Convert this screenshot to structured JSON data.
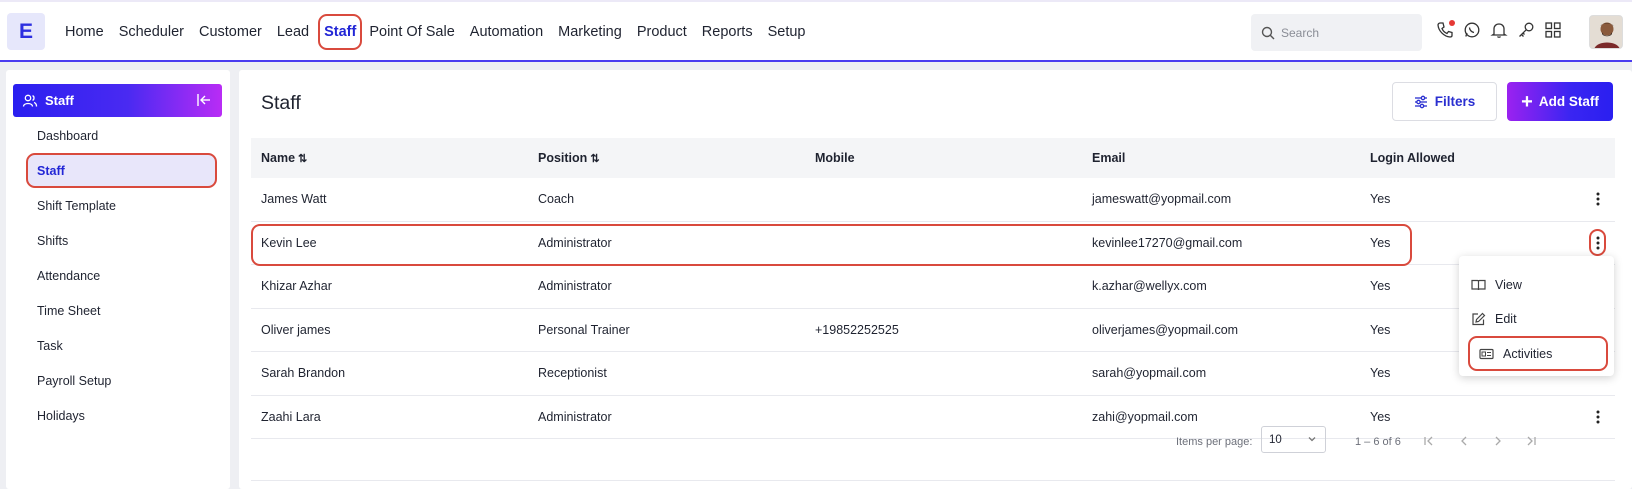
{
  "app": {
    "logo_letter": "E",
    "nav": [
      {
        "label": "Home"
      },
      {
        "label": "Scheduler"
      },
      {
        "label": "Customer"
      },
      {
        "label": "Lead"
      },
      {
        "label": "Staff",
        "active": true
      },
      {
        "label": "Point Of Sale"
      },
      {
        "label": "Automation"
      },
      {
        "label": "Marketing"
      },
      {
        "label": "Product"
      },
      {
        "label": "Reports"
      },
      {
        "label": "Setup"
      }
    ],
    "search": {
      "placeholder": "Search"
    },
    "icons": [
      "phone-icon",
      "whatsapp-icon",
      "bell-icon",
      "key-icon",
      "apps-grid-icon"
    ]
  },
  "sidebar": {
    "header": "Staff",
    "items": [
      {
        "label": "Dashboard"
      },
      {
        "label": "Staff",
        "active": true
      },
      {
        "label": "Shift Template"
      },
      {
        "label": "Shifts"
      },
      {
        "label": "Attendance"
      },
      {
        "label": "Time Sheet"
      },
      {
        "label": "Task"
      },
      {
        "label": "Payroll Setup"
      },
      {
        "label": "Holidays"
      }
    ]
  },
  "main": {
    "title": "Staff",
    "filters_label": "Filters",
    "add_label": "Add Staff",
    "columns": {
      "name": "Name",
      "position": "Position",
      "mobile": "Mobile",
      "email": "Email",
      "login": "Login Allowed"
    },
    "rows": [
      {
        "name": "James Watt",
        "position": "Coach",
        "mobile": "",
        "email": "jameswatt@yopmail.com",
        "login": "Yes"
      },
      {
        "name": "Kevin Lee",
        "position": "Administrator",
        "mobile": "",
        "email": "kevinlee17270@gmail.com",
        "login": "Yes"
      },
      {
        "name": "Khizar Azhar",
        "position": "Administrator",
        "mobile": "",
        "email": "k.azhar@wellyx.com",
        "login": "Yes"
      },
      {
        "name": "Oliver james",
        "position": "Personal Trainer",
        "mobile": "+19852252525",
        "email": "oliverjames@yopmail.com",
        "login": "Yes"
      },
      {
        "name": "Sarah Brandon",
        "position": "Receptionist",
        "mobile": "",
        "email": "sarah@yopmail.com",
        "login": "Yes"
      },
      {
        "name": "Zaahi Lara",
        "position": "Administrator",
        "mobile": "",
        "email": "zahi@yopmail.com",
        "login": "Yes"
      }
    ],
    "pager": {
      "items_label": "Items per page:",
      "page_size": "10",
      "range": "1 – 6 of 6"
    }
  },
  "row_menu": {
    "items": [
      {
        "label": "View",
        "icon": "book-open-icon"
      },
      {
        "label": "Edit",
        "icon": "edit-icon"
      },
      {
        "label": "Activities",
        "icon": "id-card-icon"
      }
    ]
  },
  "colors": {
    "accent": "#2226d6",
    "highlight": "#d94a3d",
    "gradient_start": "#2a1ff0",
    "gradient_end": "#b92cf5"
  }
}
